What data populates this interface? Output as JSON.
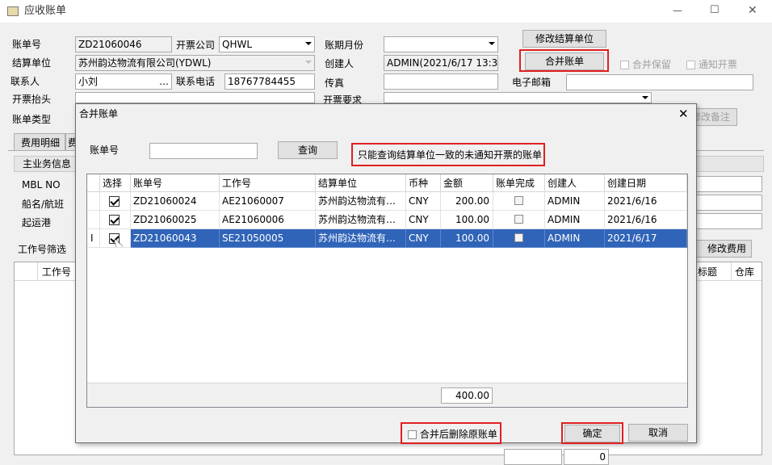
{
  "window": {
    "title": "应收账单",
    "minimize_glyph": "—",
    "maximize_glyph": "☐",
    "close_glyph": "✕"
  },
  "form": {
    "bill_no_label": "账单号",
    "bill_no_value": "ZD21060046",
    "invoice_company_label": "开票公司",
    "invoice_company_value": "QHWL",
    "period_label": "账期月份",
    "period_value": "",
    "modify_settle_button": "修改结算单位",
    "settle_unit_label": "结算单位",
    "settle_unit_value": "苏州韵达物流有限公司(YDWL)",
    "creator_label": "创建人",
    "creator_value": "ADMIN(2021/6/17 13:38",
    "merge_bill_button": "合并账单",
    "merge_keep_label": "合并保留",
    "notify_invoice_label": "通知开票",
    "contact_label": "联系人",
    "contact_value": "小刘",
    "contact_more": "…",
    "phone_label": "联系电话",
    "phone_value": "18767784455",
    "fax_label": "传真",
    "fax_value": "",
    "email_label": "电子邮箱",
    "email_value": "",
    "invoice_title_label": "开票抬头",
    "invoice_req_label": "开票要求",
    "bill_type_label": "账单类型",
    "remark_button": "修改备注"
  },
  "tabs": {
    "fee_detail": "费用明细",
    "second_tab_partial": "费"
  },
  "left_panel": {
    "main_business": "主业务信息",
    "mbl_no": "MBL NO",
    "vessel": "船名/航班",
    "pol": "起运港"
  },
  "job_filter_label": "工作号筛选",
  "modify_fee_button": "修改费用",
  "lower_grid": {
    "col_job": "工作号",
    "col_title": "标题",
    "col_warehouse": "仓库"
  },
  "footer_total": "0",
  "dialog": {
    "title": "合并账单",
    "close_glyph": "✕",
    "bill_no_label": "账单号",
    "bill_no_value": "",
    "query_button": "查询",
    "notice": "只能查询结算单位一致的未通知开票的账单",
    "columns": [
      "选择",
      "账单号",
      "工作号",
      "结算单位",
      "币种",
      "金额",
      "账单完成",
      "创建人",
      "创建日期"
    ],
    "rows": [
      {
        "checked": true,
        "bill_no": "ZD21060024",
        "job_no": "AE21060007",
        "settle_unit": "苏州韵达物流有…",
        "currency": "CNY",
        "amount": "200.00",
        "completed": false,
        "creator": "ADMIN",
        "date": "2021/6/16"
      },
      {
        "checked": true,
        "bill_no": "ZD21060025",
        "job_no": "AE21060006",
        "settle_unit": "苏州韵达物流有…",
        "currency": "CNY",
        "amount": "100.00",
        "completed": false,
        "creator": "ADMIN",
        "date": "2021/6/16"
      },
      {
        "checked": true,
        "bill_no": "ZD21060043",
        "job_no": "SE21050005",
        "settle_unit": "苏州韵达物流有…",
        "currency": "CNY",
        "amount": "100.00",
        "completed": false,
        "creator": "ADMIN",
        "date": "2021/6/17"
      }
    ],
    "row_cursor_glyph": "I",
    "total_amount": "400.00",
    "delete_original_label": "合并后删除原账单",
    "ok_button": "确定",
    "cancel_button": "取消"
  },
  "colors": {
    "highlight_red": "#e02020",
    "selected_row": "#3064b8"
  }
}
